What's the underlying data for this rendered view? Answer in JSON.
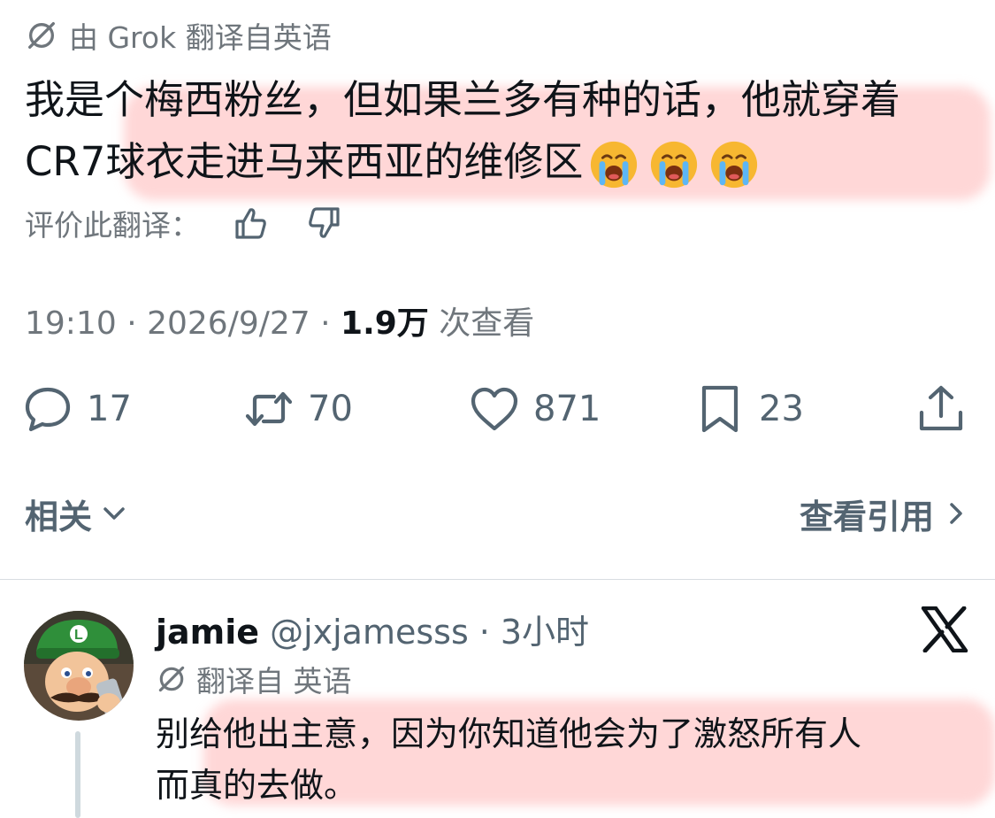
{
  "tweet": {
    "translated_by": "由 Grok 翻译自英语",
    "text_line1": "我是个梅西粉丝，但如果兰多有种的话，他就穿着",
    "text_line2": "CR7球衣走进马来西亚的维修区",
    "emojis": [
      "loudly-crying-face",
      "loudly-crying-face",
      "loudly-crying-face"
    ],
    "rate_label": "评价此翻译：",
    "time": "19:10",
    "sep1": " · ",
    "date": "2026/9/27",
    "sep2": " · ",
    "views": "1.9万",
    "views_label": " 次查看"
  },
  "actions": {
    "replies": "17",
    "reposts": "70",
    "likes": "871",
    "bookmarks": "23"
  },
  "related": {
    "left_label": "相关",
    "right_label": "查看引用"
  },
  "reply": {
    "name": "jamie",
    "handle": "@jxjamesss",
    "sep": "·",
    "time": "3小时",
    "translated_label": "翻译自 英语",
    "text_line1": "别给他出主意，因为你知道他会为了激怒所有人",
    "text_line2": "而真的去做。"
  },
  "colors": {
    "text": "#0f1419",
    "secondary": "#536471",
    "highlight": "#ffb6b6"
  }
}
